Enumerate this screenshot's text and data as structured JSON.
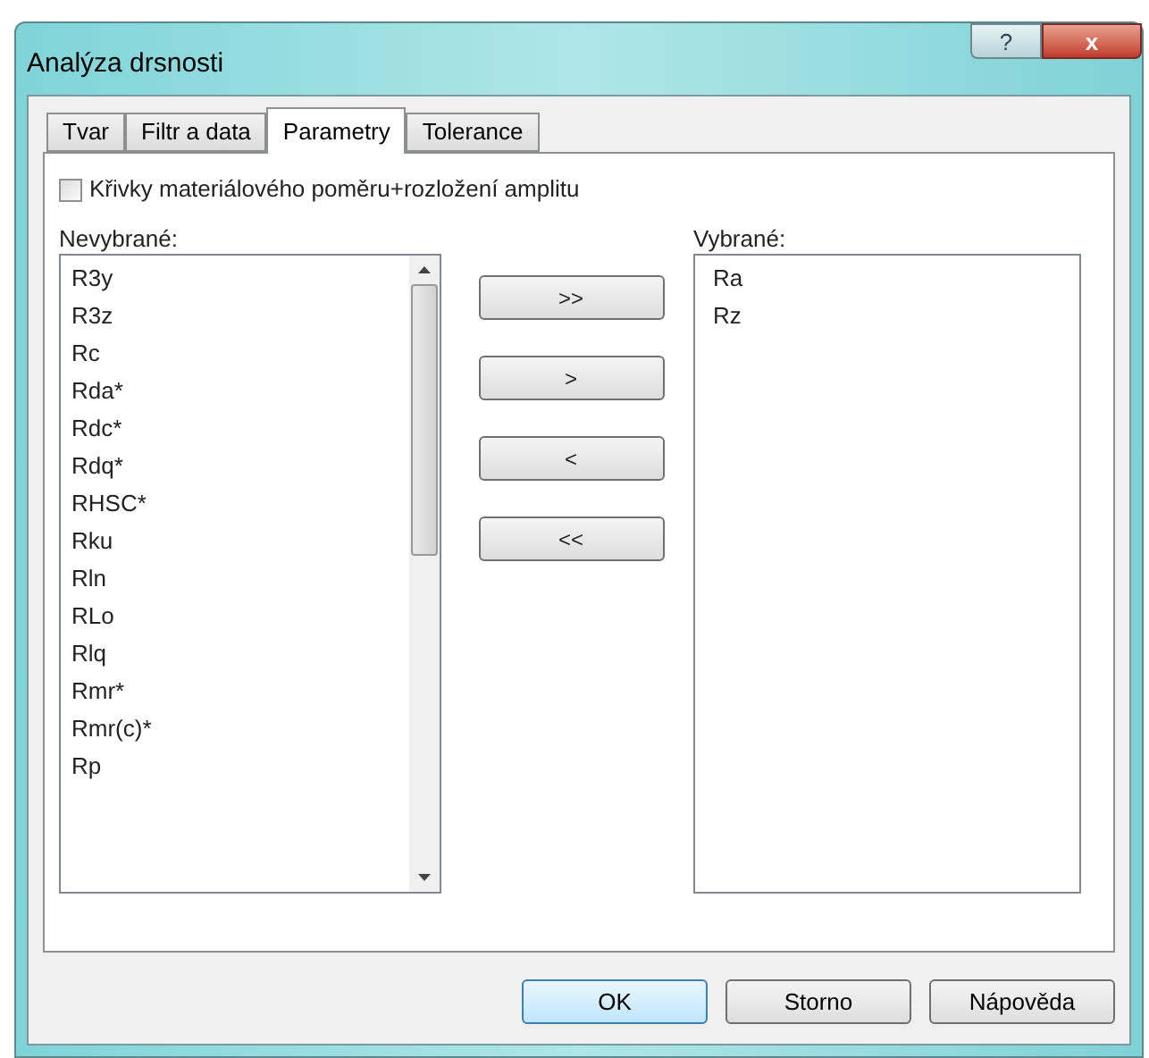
{
  "window": {
    "title": "Analýza drsnosti",
    "help_button": "?",
    "close_button": "x"
  },
  "tabs": [
    {
      "label": "Tvar",
      "selected": false
    },
    {
      "label": "Filtr a data",
      "selected": false
    },
    {
      "label": "Parametry",
      "selected": true
    },
    {
      "label": "Tolerance",
      "selected": false
    }
  ],
  "checkbox": {
    "label": "Křivky materiálového poměru+rozložení amplitu",
    "checked": false
  },
  "unselected": {
    "label": "Nevybrané:",
    "items": [
      "R3y",
      "R3z",
      "Rc",
      "Rda*",
      "Rdc*",
      "Rdq*",
      "RHSC*",
      "Rku",
      "Rln",
      "RLo",
      "Rlq",
      "Rmr*",
      "Rmr(c)*",
      "Rp"
    ]
  },
  "move_buttons": [
    ">>",
    ">",
    "<",
    "<<"
  ],
  "selected": {
    "label": "Vybrané:",
    "items": [
      "Ra",
      "Rz"
    ]
  },
  "buttons": [
    {
      "label": "OK",
      "default": true
    },
    {
      "label": "Storno",
      "default": false
    },
    {
      "label": "Nápověda",
      "default": false
    }
  ]
}
